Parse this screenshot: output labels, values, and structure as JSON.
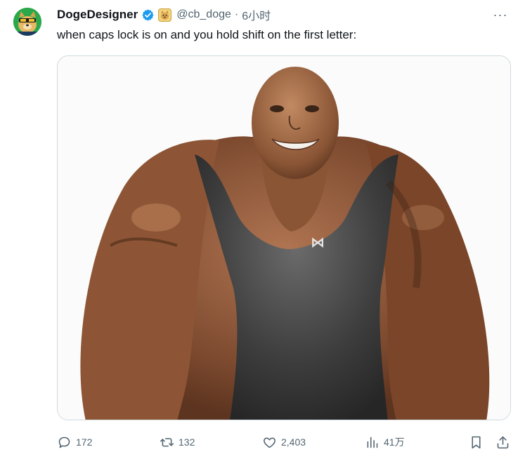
{
  "author": {
    "display_name": "DogeDesigner",
    "handle": "@cb_doge",
    "separator": "·",
    "time": "6小时",
    "verified_color": "#1d9bf0"
  },
  "tweet": {
    "text": "when caps lock is on and you hold shift on the first letter:"
  },
  "menu": {
    "more_label": "···"
  },
  "actions": {
    "replies": "172",
    "retweets": "132",
    "likes": "2,403",
    "views": "41万"
  },
  "icons": {
    "reply": "reply-icon",
    "retweet": "retweet-icon",
    "like": "heart-icon",
    "views": "views-icon",
    "bookmark": "bookmark-icon",
    "share": "share-icon"
  },
  "colors": {
    "text_primary": "#0f1419",
    "text_secondary": "#536471",
    "border": "#cfd9de",
    "accent": "#1d9bf0"
  }
}
